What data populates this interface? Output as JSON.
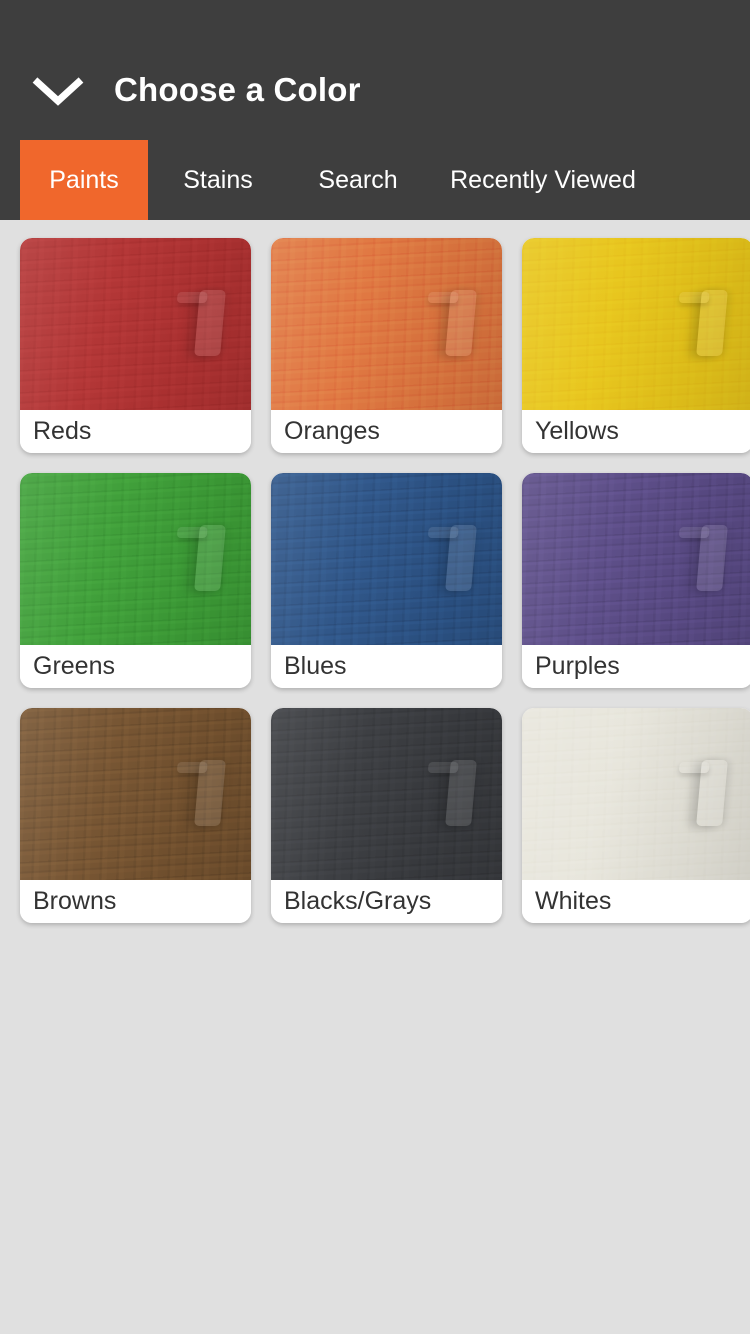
{
  "header": {
    "title": "Choose a Color",
    "back_icon": "chevron-down-icon",
    "background_color": "#3e3e3e"
  },
  "tabs": {
    "active_index": 0,
    "active_color": "#f0672c",
    "items": [
      {
        "label": "Paints",
        "active": true
      },
      {
        "label": "Stains",
        "active": false
      },
      {
        "label": "Search",
        "active": false
      },
      {
        "label": "Recently Viewed",
        "active": false
      }
    ]
  },
  "grid": {
    "background_color": "#e0e0e0",
    "columns": 3,
    "cards": [
      {
        "label": "Reds",
        "color": "#b13232"
      },
      {
        "label": "Oranges",
        "color": "#e0763f"
      },
      {
        "label": "Yellows",
        "color": "#e8c51a"
      },
      {
        "label": "Greens",
        "color": "#3d9e37"
      },
      {
        "label": "Blues",
        "color": "#2c5386"
      },
      {
        "label": "Purples",
        "color": "#5a4b86"
      },
      {
        "label": "Browns",
        "color": "#74522f"
      },
      {
        "label": "Blacks/Grays",
        "color": "#393b3f"
      },
      {
        "label": "Whites",
        "color": "#e8e6dc"
      }
    ]
  }
}
